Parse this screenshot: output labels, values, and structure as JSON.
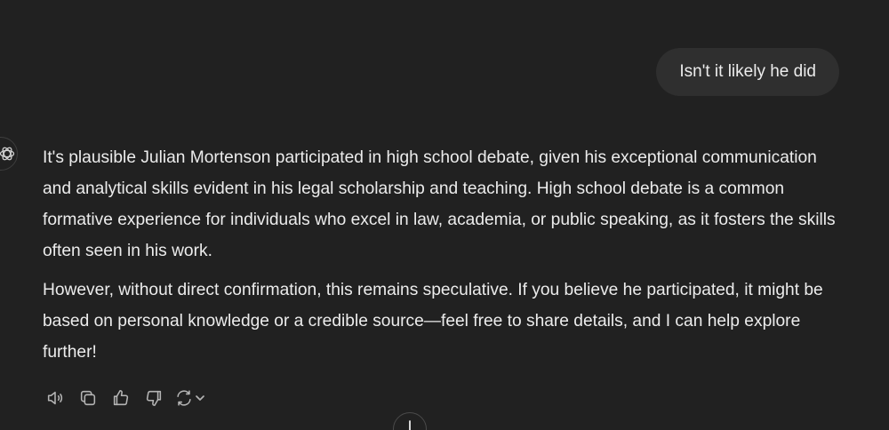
{
  "user_message": {
    "text": "Isn't it likely he did"
  },
  "assistant_message": {
    "paragraphs": [
      "It's plausible Julian Mortenson participated in high school debate, given his exceptional communication and analytical skills evident in his legal scholarship and teaching. High school debate is a common formative experience for individuals who excel in law, academia, or public speaking, as it fosters the skills often seen in his work.",
      "However, without direct confirmation, this remains speculative. If you believe he participated, it might be based on personal knowledge or a credible source—feel free to share details, and I can help explore further!"
    ]
  },
  "action_bar": {
    "icons": [
      "speaker-icon",
      "copy-icon",
      "thumbs-up-icon",
      "thumbs-down-icon",
      "regenerate-icon",
      "chevron-down-icon"
    ]
  },
  "colors": {
    "background": "#212121",
    "user_bubble": "#2f2f2f",
    "text": "#ececec",
    "icon": "#b4b4b4"
  }
}
